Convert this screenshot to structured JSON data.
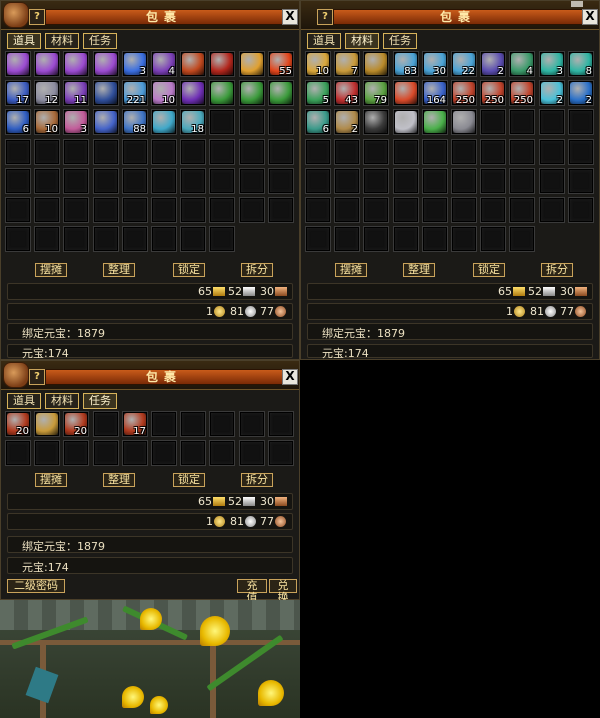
{
  "panels": [
    {
      "id": "props",
      "title": "包裹",
      "help": "?",
      "close": "X",
      "tabs": [
        "道具",
        "材料",
        "任务"
      ],
      "active_tab": 0,
      "rows": 7,
      "cols": 10,
      "unlocked_slots": 68,
      "items": [
        {
          "icon": "purple-mask-icon",
          "color": "#9b4bd1"
        },
        {
          "icon": "purple-mask-icon",
          "color": "#9b4bd1"
        },
        {
          "icon": "purple-mask-icon",
          "color": "#9b4bd1"
        },
        {
          "icon": "purple-mask-icon",
          "color": "#9b4bd1"
        },
        {
          "icon": "blue-card-icon",
          "color": "#3a6ee0",
          "count": "3"
        },
        {
          "icon": "purple-scroll-icon",
          "color": "#7b3fb7",
          "count": "4"
        },
        {
          "icon": "fire-ring-icon",
          "color": "#c0481e"
        },
        {
          "icon": "red-book-icon",
          "color": "#b2261c"
        },
        {
          "icon": "gold-ingot-pile-icon",
          "color": "#e0a030"
        },
        {
          "icon": "fire-orb-icon",
          "color": "#e2451b",
          "count": "55"
        },
        {
          "icon": "blue-tablet-icon",
          "color": "#3c5cc1",
          "count": "17"
        },
        {
          "icon": "grey-scroll-icon",
          "color": "#8c8ca0",
          "count": "12"
        },
        {
          "icon": "purple-scroll-icon",
          "color": "#7b3fb7",
          "count": "11"
        },
        {
          "icon": "blue-book-icon",
          "color": "#2f4e9a"
        },
        {
          "icon": "blue-vial-icon",
          "color": "#4c9bd8",
          "count": "221"
        },
        {
          "icon": "swirl-orb-icon",
          "color": "#b97ac8",
          "count": "10"
        },
        {
          "icon": "purple-feather-icon",
          "color": "#6f2fb5"
        },
        {
          "icon": "green-ticket-icon",
          "color": "#3a9a3a"
        },
        {
          "icon": "green-ticket-icon",
          "color": "#3a9a3a"
        },
        {
          "icon": "green-ticket-icon",
          "color": "#3a9a3a"
        },
        {
          "icon": "blue-scroll-icon",
          "color": "#2f5dc2",
          "count": "6"
        },
        {
          "icon": "brown-scroll-icon",
          "color": "#a86a3a",
          "count": "10"
        },
        {
          "icon": "pink-scroll-icon",
          "color": "#c25b9a",
          "count": "3"
        },
        {
          "icon": "blue-scroll-icon",
          "color": "#4463c9"
        },
        {
          "icon": "blue-bottle-icon",
          "color": "#3f74c5",
          "count": "88"
        },
        {
          "icon": "cyan-orb-icon",
          "color": "#3fa8c9"
        },
        {
          "icon": "cyan-potion-icon",
          "color": "#4ba9bd",
          "count": "18"
        }
      ],
      "buttons": [
        "摆摊",
        "整理",
        "锁定",
        "拆分"
      ],
      "currency_top": [
        {
          "value": "65",
          "kind": "gold-ingot"
        },
        {
          "value": "52",
          "kind": "silver-ingot"
        },
        {
          "value": "30",
          "kind": "copper-ingot"
        }
      ],
      "currency_bottom": [
        {
          "value": "1",
          "kind": "gold"
        },
        {
          "value": "81",
          "kind": "silver"
        },
        {
          "value": "77",
          "kind": "copper"
        }
      ],
      "bound_yuanbao": "绑定元宝：1879",
      "yuanbao": "元宝:174"
    },
    {
      "id": "materials",
      "title": "包裹",
      "help": "?",
      "close": "X",
      "tabs": [
        "道具",
        "材料",
        "任务"
      ],
      "active_tab": 1,
      "rows": 7,
      "cols": 10,
      "unlocked_slots": 68,
      "items": [
        {
          "icon": "gold-ingot-icon",
          "color": "#d9a63a",
          "count": "10"
        },
        {
          "icon": "gold-ingot-icon",
          "color": "#c99a3a",
          "count": "7"
        },
        {
          "icon": "gold-ingot-icon",
          "color": "#b98a2a"
        },
        {
          "icon": "blue-swirl-icon",
          "color": "#4aa3d6",
          "count": "83"
        },
        {
          "icon": "blue-swirl-icon",
          "color": "#4aa3d6",
          "count": "30"
        },
        {
          "icon": "blue-swirl-icon",
          "color": "#4aa3d6",
          "count": "22"
        },
        {
          "icon": "purple-crystal-icon",
          "color": "#5a4cb0",
          "count": "2"
        },
        {
          "icon": "green-card-icon",
          "color": "#3a9a6a",
          "count": "4"
        },
        {
          "icon": "teal-gem-icon",
          "color": "#2fb5a3",
          "count": "3"
        },
        {
          "icon": "teal-gem-icon",
          "color": "#2fb5a3",
          "count": "8"
        },
        {
          "icon": "green-swirl-icon",
          "color": "#3aa05a",
          "count": "5"
        },
        {
          "icon": "red-claw-icon",
          "color": "#c03030",
          "count": "43"
        },
        {
          "icon": "green-blade-icon",
          "color": "#5aa040",
          "count": "79"
        },
        {
          "icon": "red-apple-icon",
          "color": "#d84a2a"
        },
        {
          "icon": "blue-scroll-icon",
          "color": "#3a62c9",
          "count": "164"
        },
        {
          "icon": "red-scroll-icon",
          "color": "#c0432c",
          "count": "250"
        },
        {
          "icon": "red-scroll-icon",
          "color": "#c0432c",
          "count": "250"
        },
        {
          "icon": "red-scroll-icon",
          "color": "#c0432c",
          "count": "250"
        },
        {
          "icon": "cyan-crystal-ball-icon",
          "color": "#4ac0d8",
          "count": "2"
        },
        {
          "icon": "blue-jewel-icon",
          "color": "#2a70c9",
          "count": "2"
        },
        {
          "icon": "teal-blade-icon",
          "color": "#3a9a8a",
          "count": "6"
        },
        {
          "icon": "brown-feather-icon",
          "color": "#b08a4a",
          "count": "2"
        },
        {
          "icon": "black-stone-icon",
          "color": "#3a3a3a"
        },
        {
          "icon": "silver-ore-icon",
          "color": "#c0c0c8"
        },
        {
          "icon": "green-crystal-icon",
          "color": "#4ab04a"
        },
        {
          "icon": "grey-rock-icon",
          "color": "#8a8a92"
        }
      ],
      "buttons": [
        "摆摊",
        "整理",
        "锁定",
        "拆分"
      ],
      "currency_top": [
        {
          "value": "65",
          "kind": "gold-ingot"
        },
        {
          "value": "52",
          "kind": "silver-ingot"
        },
        {
          "value": "30",
          "kind": "copper-ingot"
        }
      ],
      "currency_bottom": [
        {
          "value": "1",
          "kind": "gold"
        },
        {
          "value": "81",
          "kind": "silver"
        },
        {
          "value": "77",
          "kind": "copper"
        }
      ],
      "bound_yuanbao": "绑定元宝：1879",
      "yuanbao": "元宝:174"
    },
    {
      "id": "quest",
      "title": "包裹",
      "help": "?",
      "close": "X",
      "tabs": [
        "道具",
        "材料",
        "任务"
      ],
      "active_tab": 2,
      "rows": 2,
      "cols": 10,
      "unlocked_slots": 20,
      "items": [
        {
          "icon": "red-scroll-icon",
          "color": "#b03a1e",
          "count": "20"
        },
        {
          "icon": "gold-book-icon",
          "color": "#c89a3a"
        },
        {
          "icon": "red-scroll-icon",
          "color": "#b03a1e",
          "count": "20"
        },
        null,
        {
          "icon": "red-scroll-icon",
          "color": "#b03a1e",
          "count": "17"
        }
      ],
      "buttons": [
        "摆摊",
        "整理",
        "锁定",
        "拆分"
      ],
      "currency_top": [
        {
          "value": "65",
          "kind": "gold-ingot"
        },
        {
          "value": "52",
          "kind": "silver-ingot"
        },
        {
          "value": "30",
          "kind": "copper-ingot"
        }
      ],
      "currency_bottom": [
        {
          "value": "1",
          "kind": "gold"
        },
        {
          "value": "81",
          "kind": "silver"
        },
        {
          "value": "77",
          "kind": "copper"
        }
      ],
      "bound_yuanbao": "绑定元宝：1879",
      "yuanbao": "元宝:174",
      "footer_buttons": {
        "left": "二级密码",
        "recharge": "充值",
        "exchange": "兑换"
      }
    }
  ]
}
